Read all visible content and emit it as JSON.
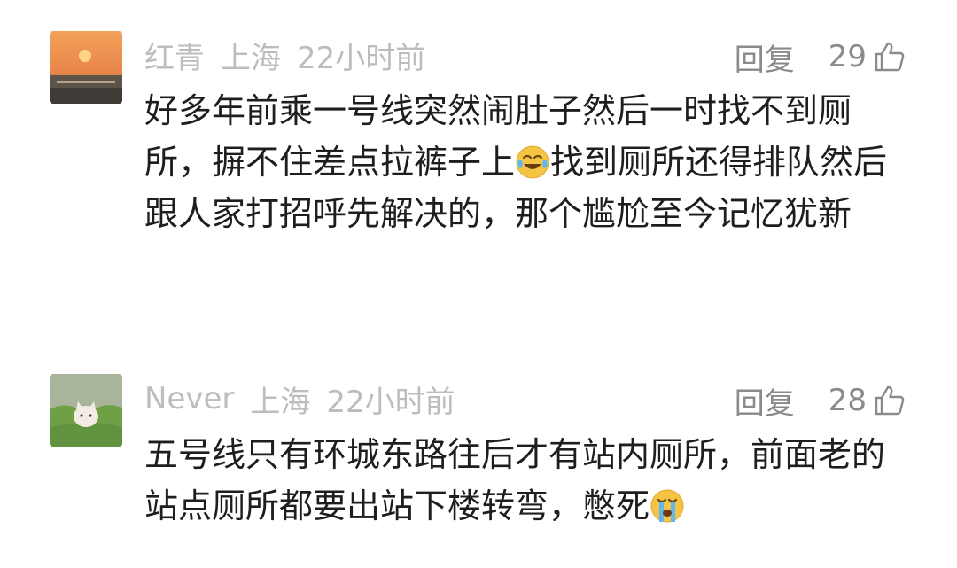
{
  "comments": [
    {
      "username": "红青",
      "location": "上海",
      "time": "22小时前",
      "reply_label": "回复",
      "likes": "29",
      "text_before_emoji": "好多年前乘一号线突然闹肚子然后一时找不到厕所，摒不住差点拉裤子上",
      "emoji": "laughing-tears-icon",
      "text_after_emoji": "找到厕所还得排队然后跟人家打招呼先解决的，那个尴尬至今记忆犹新"
    },
    {
      "username": "Never",
      "location": "上海",
      "time": "22小时前",
      "reply_label": "回复",
      "likes": "28",
      "text_before_emoji": "五号线只有环城东路往后才有站内厕所，前面老的站点厕所都要出站下楼转弯，憋死",
      "emoji": "crying-face-icon",
      "text_after_emoji": ""
    }
  ],
  "colors": {
    "meta_text": "#bdbdbd",
    "action_text": "#8a8a8a",
    "body_text": "#1e1e1e"
  }
}
